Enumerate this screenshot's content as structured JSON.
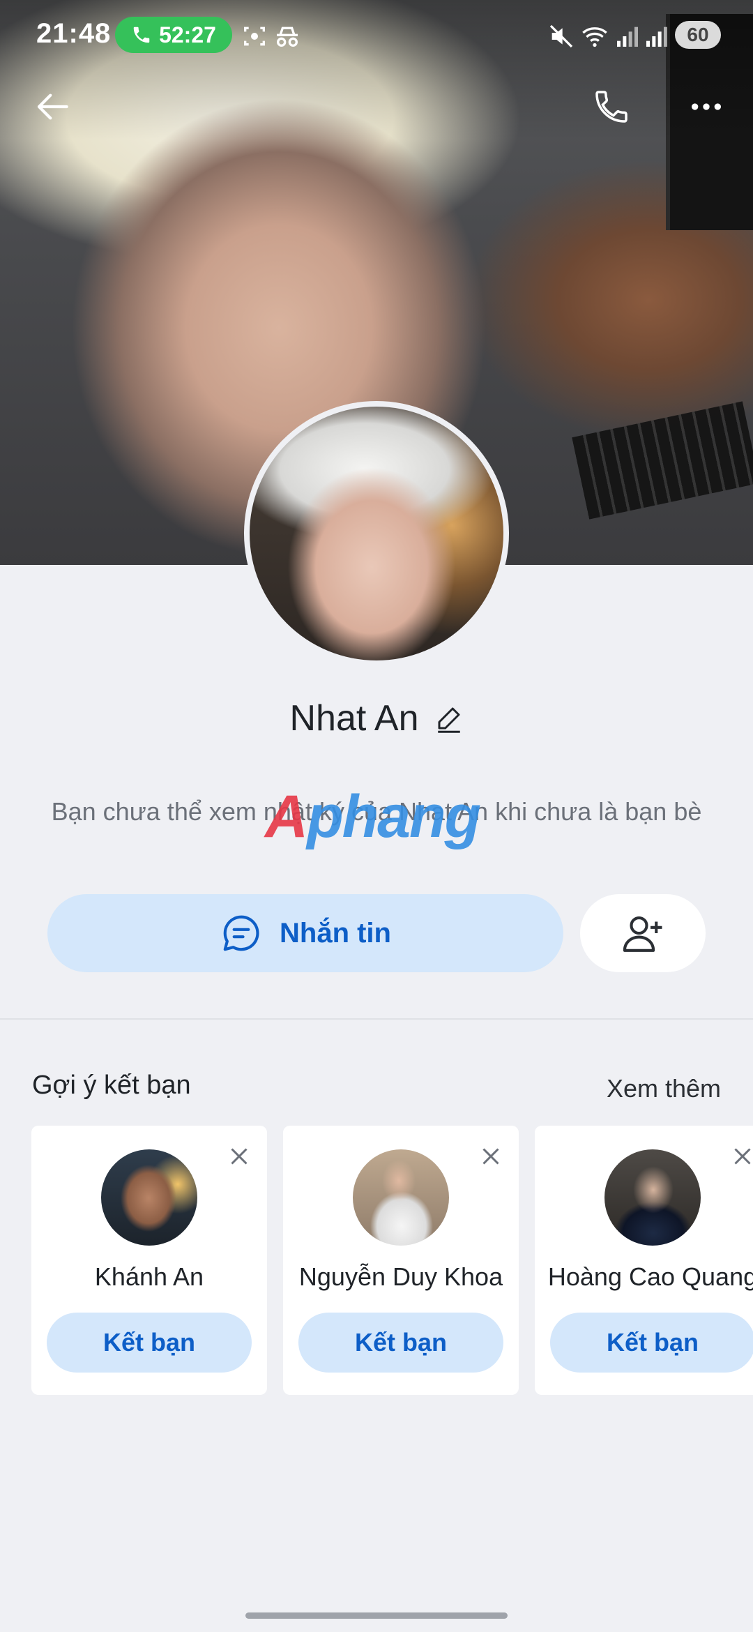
{
  "status_bar": {
    "time": "21:48",
    "call_timer": "52:27",
    "battery": "60"
  },
  "profile": {
    "name": "Nhat An",
    "notice": "Bạn chưa thể xem nhật ký của Nhat An khi chưa là bạn bè",
    "message_button": "Nhắn tin"
  },
  "watermark": {
    "part1": "A",
    "part2": "phang"
  },
  "suggestions": {
    "title": "Gợi ý kết bạn",
    "see_more": "Xem thêm",
    "cards": [
      {
        "name": "Khánh An",
        "button": "Kết bạn"
      },
      {
        "name": "Nguyễn Duy Khoa",
        "button": "Kết bạn"
      },
      {
        "name": "Hoàng Cao Quang",
        "button": "Kết bạn"
      }
    ]
  },
  "colors": {
    "accent": "#0d5ec7",
    "button_bg": "#d4e7fb",
    "call_pill": "#35c15a",
    "page_bg": "#eff0f4"
  }
}
